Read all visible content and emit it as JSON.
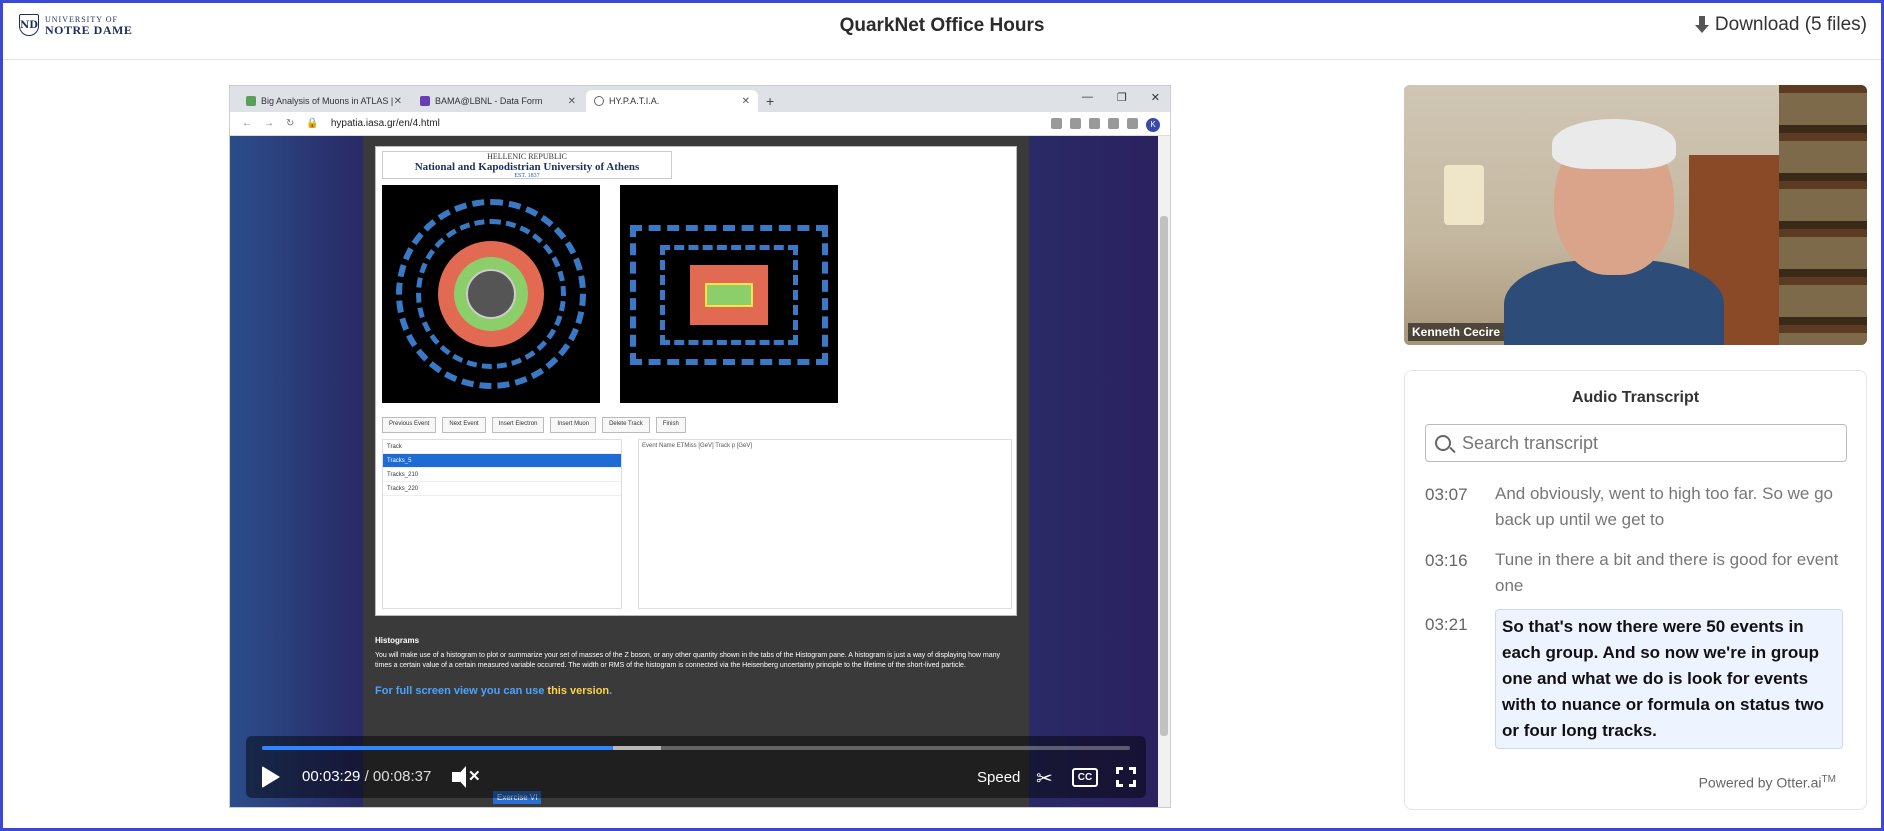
{
  "header": {
    "logo_line1": "UNIVERSITY OF",
    "logo_line2": "NOTRE DAME",
    "title": "QuarkNet Office Hours",
    "download_label": "Download (5 files)"
  },
  "browser": {
    "tabs": [
      {
        "label": "Big Analysis of Muons in ATLAS |"
      },
      {
        "label": "BAMA@LBNL - Data Form"
      },
      {
        "label": "HY.P.A.T.I.A."
      }
    ],
    "url": "hypatia.iasa.gr/en/4.html",
    "profile_initial": "K"
  },
  "hypatia": {
    "banner_line1": "HELLENIC REPUBLIC",
    "banner_line2": "National and Kapodistrian University of Athens",
    "banner_line3": "EST. 1837",
    "buttons": [
      "Previous Event",
      "Next Event",
      "Insert Electron",
      "Insert Muon",
      "Delete Track",
      "Finish"
    ],
    "track_rows": [
      "Tracks_5",
      "Tracks_210",
      "Tracks_220"
    ],
    "event_header": "Event Name   ETMiss [GeV]   Track   p [GeV]",
    "hist_heading": "Histograms",
    "hist_text": "You will make use of a histogram to plot or summarize your set of masses of the Z boson, or any other quantity shown in the tabs of the Histogram pane. A histogram is just a way of displaying how many times a certain value of a certain measured variable occurred. The width or RMS of the histogram is connected via the Heisenberg uncertainty principle to the lifetime of the short-lived particle.",
    "full_screen_prefix": "For full screen view you can use",
    "full_screen_link": "this version",
    "exercise_button": "Exercise VI"
  },
  "player": {
    "current_time": "00:03:29",
    "duration": "00:08:37",
    "progress_fraction": 0.404,
    "buffered_fraction": 0.46,
    "speed_label": "Speed",
    "cc_label": "CC",
    "accent": "#2f86ff"
  },
  "webcam": {
    "name": "Kenneth Cecire"
  },
  "transcript": {
    "title": "Audio Transcript",
    "search_placeholder": "Search transcript",
    "entries": [
      {
        "time": "03:07",
        "text": "And obviously, went to high too far. So we go back up until we get to"
      },
      {
        "time": "03:16",
        "text": "Tune in there a bit and there is good for event one"
      },
      {
        "time": "03:21",
        "text": "So that's now there were 50 events in each group. And so now we're in group one and what we do is look for events with to nuance or formula on status two or four long tracks."
      }
    ],
    "powered_by": "Powered by Otter.ai",
    "tm": "TM"
  }
}
